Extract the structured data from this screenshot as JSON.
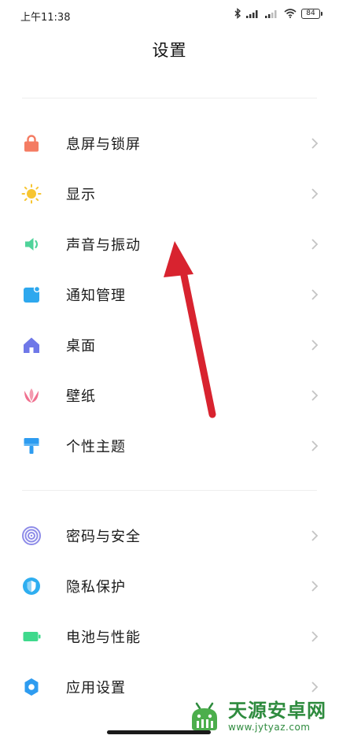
{
  "status_bar": {
    "time": "上午11:38",
    "battery": "84"
  },
  "header": {
    "title": "设置"
  },
  "groups": [
    {
      "items": [
        {
          "label": "息屏与锁屏",
          "icon": "lock-icon",
          "color": "#f47c63"
        },
        {
          "label": "显示",
          "icon": "sun-icon",
          "color": "#f7c531"
        },
        {
          "label": "声音与振动",
          "icon": "speaker-icon",
          "color": "#4fd39a"
        },
        {
          "label": "通知管理",
          "icon": "notification-icon",
          "color": "#2ea8ee"
        },
        {
          "label": "桌面",
          "icon": "home-icon",
          "color": "#6f78e8"
        },
        {
          "label": "壁纸",
          "icon": "tulip-icon",
          "color": "#f0708f"
        },
        {
          "label": "个性主题",
          "icon": "brush-icon",
          "color": "#2e9cf0"
        }
      ]
    },
    {
      "items": [
        {
          "label": "密码与安全",
          "icon": "fingerprint-icon",
          "color": "#8e8ce8"
        },
        {
          "label": "隐私保护",
          "icon": "privacy-shield-icon",
          "color": "#2eaef0"
        },
        {
          "label": "电池与性能",
          "icon": "battery-icon",
          "color": "#3fd98c"
        },
        {
          "label": "应用设置",
          "icon": "gear-icon",
          "color": "#2e9cf0"
        }
      ]
    }
  ],
  "watermark": {
    "title": "天源安卓网",
    "url": "www.jytyaz.com"
  },
  "colors": {
    "annotation_arrow": "#d8232f",
    "chevron": "#c4c4c4",
    "watermark": "#2e8b3e"
  }
}
